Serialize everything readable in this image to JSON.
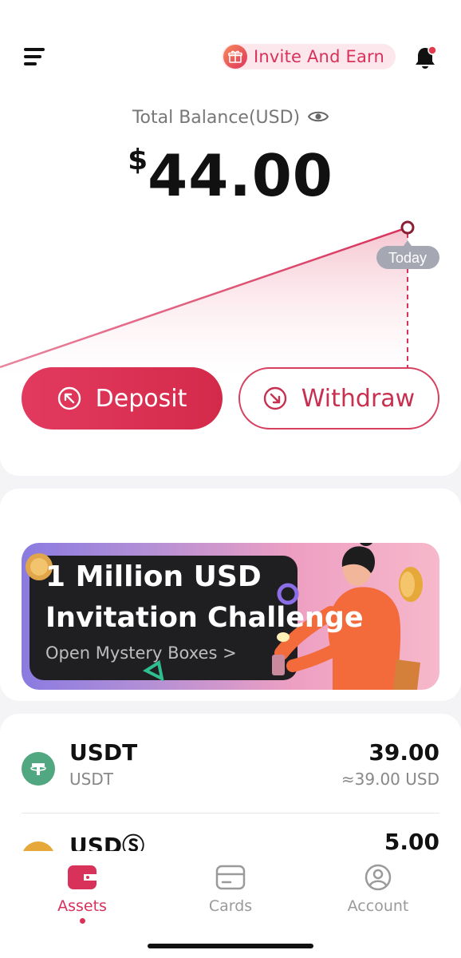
{
  "header": {
    "menu_icon": "hamburger-menu-icon",
    "invite_label": "Invite And Earn",
    "invite_icon": "gift-icon",
    "bell_icon": "bell-icon"
  },
  "balance": {
    "label": "Total Balance(USD)",
    "currency_symbol": "$",
    "amount": "44.00",
    "eye_icon": "eye-icon"
  },
  "chart": {
    "today_label": "Today",
    "accent": "#d8315a"
  },
  "actions": {
    "deposit_label": "Deposit",
    "withdraw_label": "Withdraw"
  },
  "promo": {
    "title_line1": "1 Million USD",
    "title_line2": "Invitation Challenge",
    "subtitle": "Open Mystery Boxes >"
  },
  "assets": [
    {
      "symbol": "USDT",
      "name": "USDT",
      "amount": "39.00",
      "usd_value": "≈39.00 USD",
      "color": "#50a780"
    },
    {
      "symbol": "USDⓈ",
      "name": "",
      "amount": "5.00",
      "usd_value": "",
      "color": "#e7a83a"
    }
  ],
  "tabs": [
    {
      "label": "Assets",
      "icon": "wallet-icon",
      "active": true
    },
    {
      "label": "Cards",
      "icon": "card-icon",
      "active": false
    },
    {
      "label": "Account",
      "icon": "user-circle-icon",
      "active": false
    }
  ],
  "colors": {
    "brand": "#d8315a",
    "usdt": "#50a780"
  }
}
